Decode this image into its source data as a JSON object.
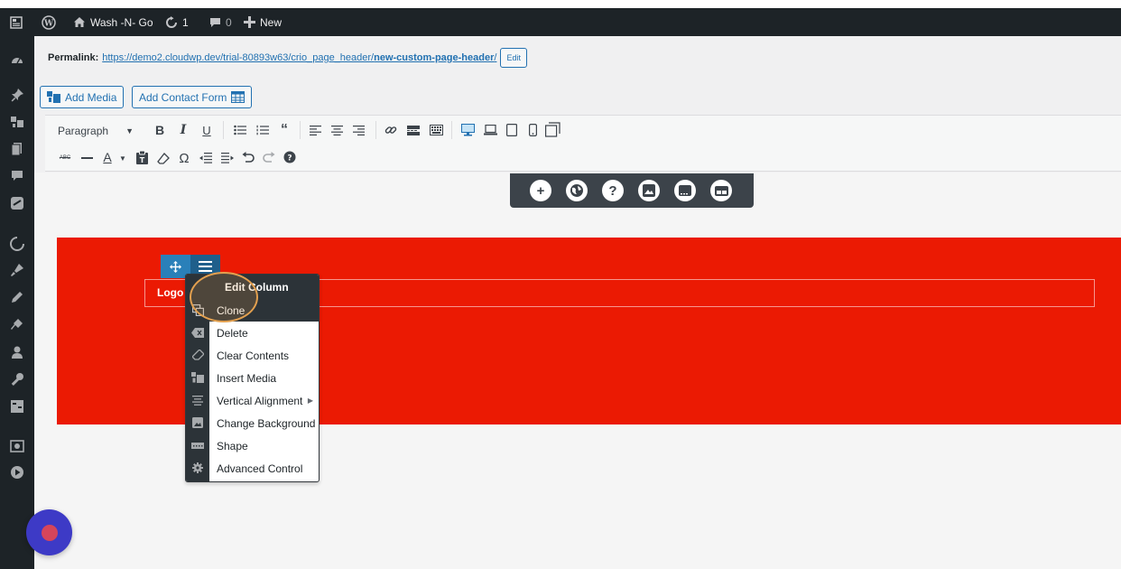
{
  "adminbar": {
    "site_name": "Wash -N- Go",
    "updates_count": "1",
    "comments_count": "0",
    "new_label": "New"
  },
  "side_menu": {
    "icons": [
      "dashboard-icon",
      "pin-icon",
      "media-icon",
      "pages-icon",
      "comments-icon",
      "forms-icon",
      "theme-icon",
      "customize-icon",
      "edit-icon",
      "plugins-icon",
      "users-icon",
      "tools-icon",
      "settings-icon",
      "camera-icon",
      "play-icon"
    ]
  },
  "permalink": {
    "label": "Permalink:",
    "url_base": "https://demo2.cloudwp.dev/trial-80893w63/crio_page_header/",
    "url_slug": "new-custom-page-header",
    "url_end": "/",
    "edit_label": "Edit"
  },
  "media_buttons": {
    "add_media": "Add Media",
    "add_contact_form": "Add Contact Form"
  },
  "toolbar": {
    "format_value": "Paragraph",
    "row1": [
      "bold-icon",
      "italic-icon",
      "underline-icon",
      "bullet-list-icon",
      "numbered-list-icon",
      "blockquote-icon",
      "align-left-icon",
      "align-center-icon",
      "align-right-icon",
      "link-icon",
      "read-more-icon",
      "toolbar-toggle-icon",
      "desktop-icon",
      "laptop-icon",
      "tablet-icon",
      "phone-icon",
      "fullscreen-icon"
    ],
    "row2": [
      "strikethrough-icon",
      "horizontal-line-icon",
      "text-color-icon",
      "paste-text-icon",
      "clear-formatting-icon",
      "special-character-icon",
      "outdent-icon",
      "indent-icon",
      "undo-icon",
      "redo-icon",
      "help-icon"
    ]
  },
  "float_tools": [
    "add-icon",
    "globe-icon",
    "help-icon",
    "image-icon",
    "gallery-icon",
    "layout-icon"
  ],
  "section": {
    "color": "#eb1a03",
    "logo_text": "Logo"
  },
  "context_menu": {
    "title": "Edit Column",
    "items": [
      {
        "label": "Clone",
        "icon": "clone-icon",
        "active": true
      },
      {
        "label": "Delete",
        "icon": "delete-icon"
      },
      {
        "label": "Clear Contents",
        "icon": "eraser-icon"
      },
      {
        "label": "Insert Media",
        "icon": "media-icon"
      },
      {
        "label": "Vertical Alignment",
        "icon": "align-icon",
        "submenu": true
      },
      {
        "label": "Change Background",
        "icon": "background-icon"
      },
      {
        "label": "Shape",
        "icon": "shape-icon"
      },
      {
        "label": "Advanced Control",
        "icon": "gear-icon"
      }
    ]
  },
  "colors": {
    "admin_bar": "#1d2327",
    "accent_blue": "#2271b1",
    "handle_blue": "#2a80b9",
    "fab": "#3d3ac6"
  }
}
